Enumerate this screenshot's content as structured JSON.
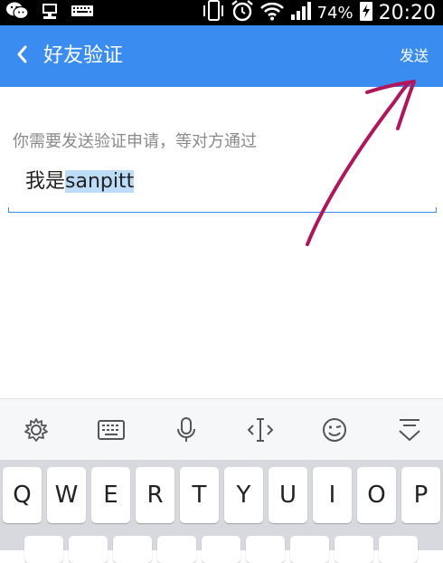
{
  "status_bar": {
    "battery_percent": "74%",
    "time": "20:20",
    "icons": [
      "wechat-icon",
      "computer-icon",
      "keyboard-icon",
      "vibrate-icon",
      "alarm-icon",
      "wifi-icon",
      "signal-icon",
      "battery-charging-icon"
    ]
  },
  "app_bar": {
    "title": "好友验证",
    "send_label": "发送",
    "back_icon": "chevron-left-icon",
    "color": "#3a8cf0"
  },
  "form": {
    "hint": "你需要发送验证申请，等对方通过",
    "input_prefix": "我是",
    "input_selected": "sanpitt"
  },
  "keyboard": {
    "toolbar_icons": [
      "settings-icon",
      "keyboard-icon",
      "microphone-icon",
      "cursor-move-icon",
      "emoji-icon",
      "hide-keyboard-icon"
    ],
    "row1": [
      "Q",
      "W",
      "E",
      "R",
      "T",
      "Y",
      "U",
      "I",
      "O",
      "P"
    ]
  },
  "annotation": {
    "arrow_color": "#b0175a"
  }
}
